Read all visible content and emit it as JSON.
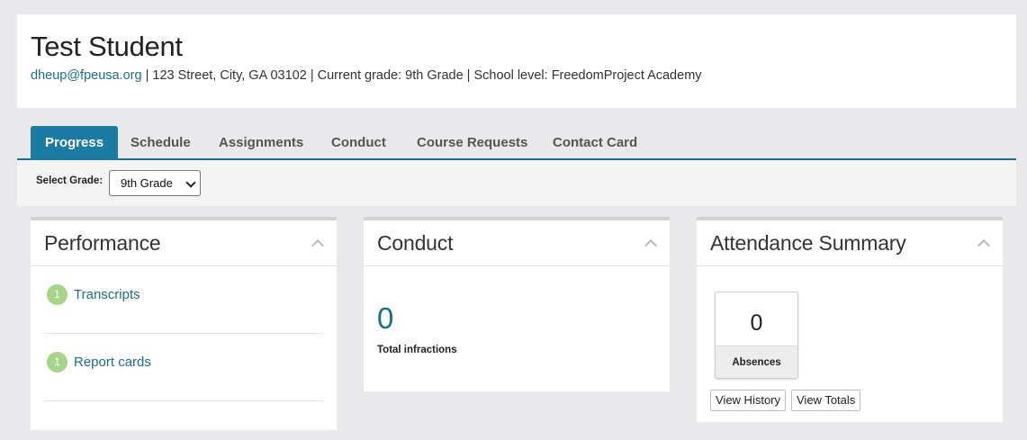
{
  "student": {
    "name": "Test Student",
    "email": "dheup@fpeusa.org",
    "details": " | 123 Street, City, GA 03102 | Current grade: 9th Grade | School level: FreedomProject Academy"
  },
  "tabs": [
    {
      "label": "Progress",
      "active": true
    },
    {
      "label": "Schedule"
    },
    {
      "label": "Assignments"
    },
    {
      "label": "Conduct"
    },
    {
      "label": "Course Requests"
    },
    {
      "label": "Contact Card"
    }
  ],
  "filter": {
    "label": "Select Grade:",
    "selected": "9th Grade"
  },
  "performance": {
    "title": "Performance",
    "items": [
      {
        "count": "1",
        "label": "Transcripts"
      },
      {
        "count": "1",
        "label": "Report cards"
      }
    ]
  },
  "conduct": {
    "title": "Conduct",
    "value": "0",
    "label": "Total infractions"
  },
  "attendance": {
    "title": "Attendance Summary",
    "absences_value": "0",
    "absences_label": "Absences",
    "view_history": "View History",
    "view_totals": "View Totals"
  },
  "colors": {
    "accent": "#1b7ba3",
    "link": "#1a6e8e",
    "badge": "#a7d38a",
    "background": "#e9e9ec"
  }
}
